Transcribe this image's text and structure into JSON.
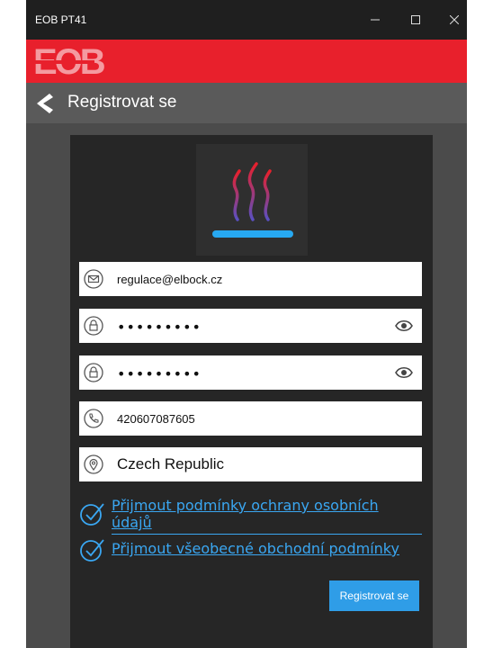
{
  "window": {
    "title": "EOB PT41"
  },
  "brand": {
    "logo_text": "EOB",
    "color": "#e8202c"
  },
  "nav": {
    "title": "Registrovat se"
  },
  "form": {
    "email": "regulace@elbock.cz",
    "password": "•••••••••",
    "password_confirm": "•••••••••",
    "phone": "420607087605",
    "country": "Czech Republic"
  },
  "consents": {
    "privacy": "Přijmout podmínky ochrany osobních údajů",
    "terms": "Přijmout všeobecné obchodní podmínky"
  },
  "submit_label": "Registrovat se",
  "colors": {
    "accent": "#3aa7f2",
    "button": "#2f9de7",
    "card": "#262626"
  }
}
